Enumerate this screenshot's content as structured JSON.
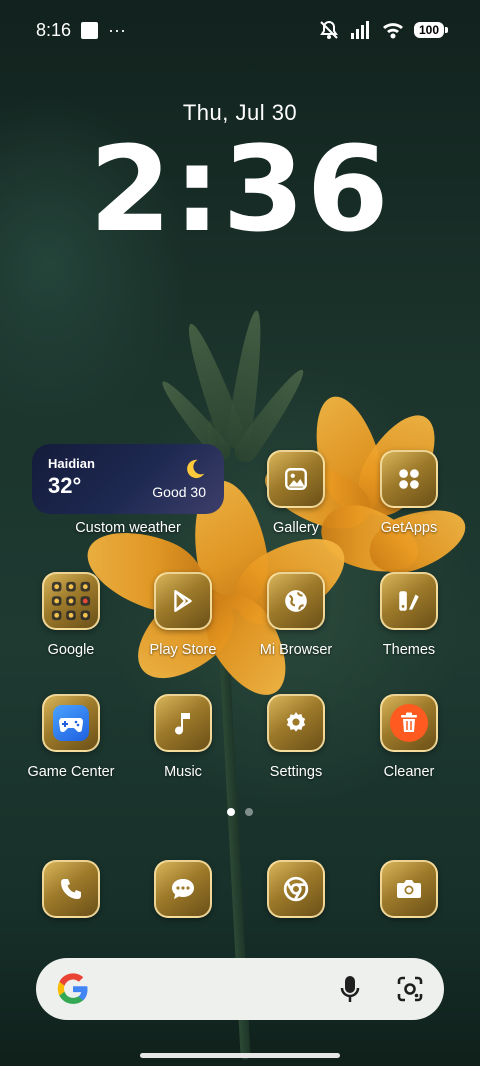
{
  "status_bar": {
    "time": "8:16",
    "more": "···",
    "battery": "100"
  },
  "lockscreen": {
    "date": "Thu, Jul 30",
    "time": "2:36"
  },
  "weather_widget": {
    "city": "Haidian",
    "temperature": "32°",
    "air_quality": "Good 30",
    "label": "Custom weather"
  },
  "apps": {
    "gallery": "Gallery",
    "getapps": "GetApps",
    "google": "Google",
    "play_store": "Play Store",
    "mi_browser": "Mi Browser",
    "themes": "Themes",
    "game_center": "Game Center",
    "music": "Music",
    "settings": "Settings",
    "cleaner": "Cleaner"
  },
  "dock": {
    "items": [
      "phone-icon",
      "messages-icon",
      "chrome-icon",
      "camera-icon"
    ]
  },
  "pager": {
    "pages": 2,
    "current": 1
  },
  "colors": {
    "icon_gold": "#b8923c",
    "cleaner_orange": "#ff5a1f",
    "game_blue": "#2b7cf5"
  }
}
